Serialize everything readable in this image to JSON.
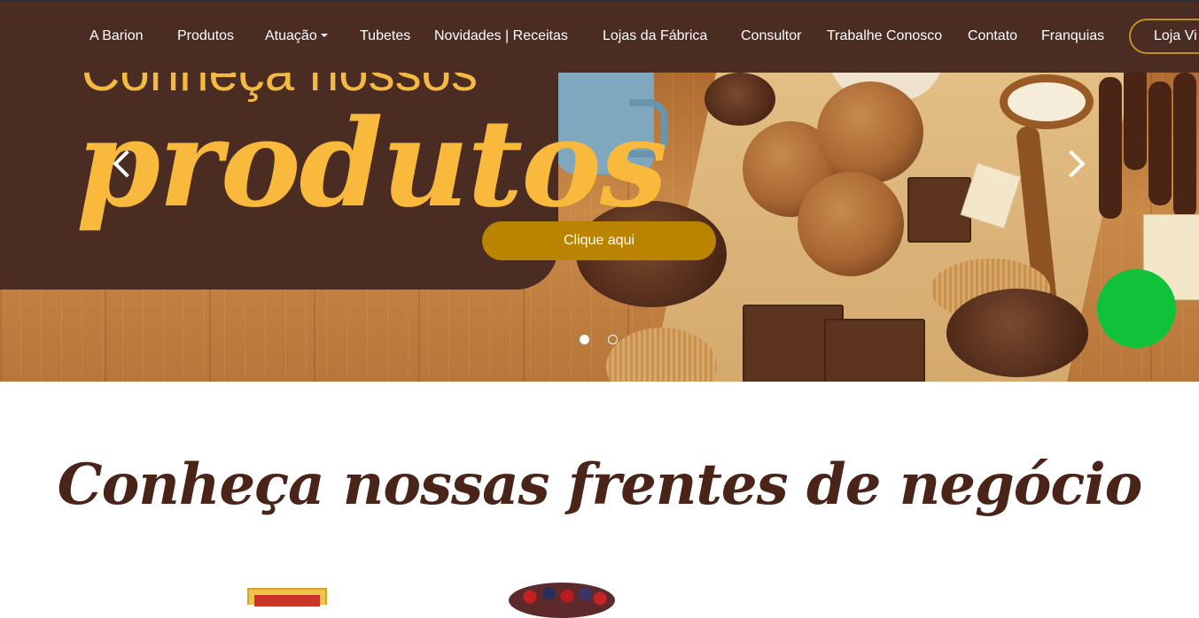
{
  "nav": {
    "items": [
      {
        "label": "A Barion"
      },
      {
        "label": "Produtos"
      },
      {
        "label": "Atuação"
      },
      {
        "label": "Tubetes"
      },
      {
        "label": "Novidades | Receitas"
      },
      {
        "label": "Lojas da Fábrica"
      },
      {
        "label": "Consultor"
      },
      {
        "label": "Trabalhe Conosco"
      },
      {
        "label": "Contato"
      },
      {
        "label": "Franquias"
      }
    ],
    "store_button": "Loja Vi"
  },
  "hero": {
    "subtitle": "Conheça nossos",
    "title": "produtos",
    "cta_label": "Clique aqui",
    "slides_total": 2,
    "active_slide": 1
  },
  "section": {
    "title": "Conheça nossas frentes de negócio"
  },
  "colors": {
    "nav_bg": "#4a2c22",
    "accent_gold": "#bb8400",
    "title_yellow": "#f9b93d",
    "section_title": "#4a2418",
    "chat_green": "#10c23a"
  }
}
